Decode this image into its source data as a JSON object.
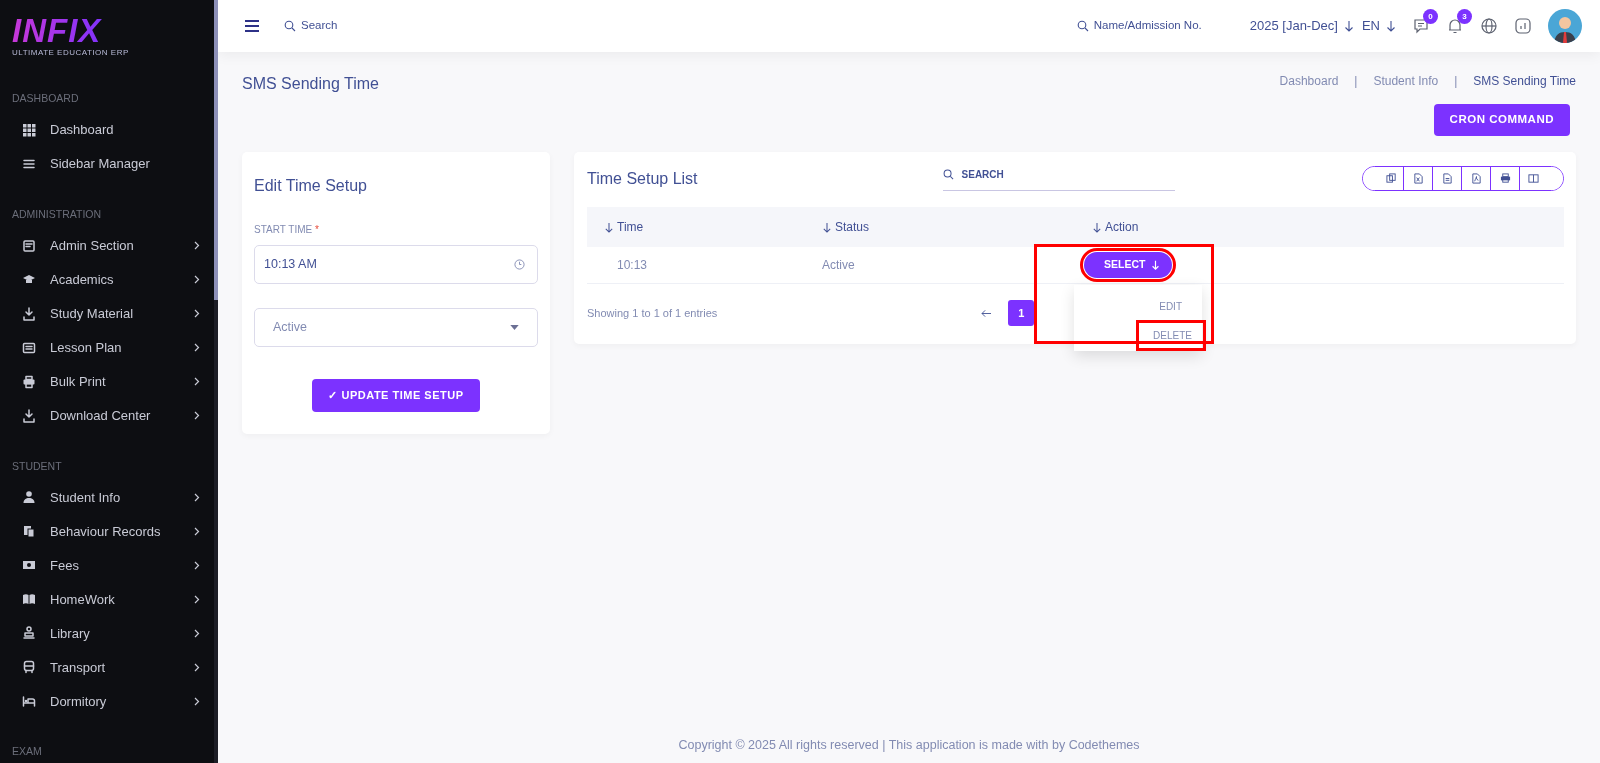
{
  "brand": {
    "name": "INFIX",
    "tagline": "ULTIMATE EDUCATION ERP"
  },
  "sidebar": {
    "sections": [
      {
        "title": "DASHBOARD",
        "items": [
          {
            "label": "Dashboard",
            "has_submenu": false
          },
          {
            "label": "Sidebar Manager",
            "has_submenu": false
          }
        ]
      },
      {
        "title": "ADMINISTRATION",
        "items": [
          {
            "label": "Admin Section",
            "has_submenu": true
          },
          {
            "label": "Academics",
            "has_submenu": true
          },
          {
            "label": "Study Material",
            "has_submenu": true
          },
          {
            "label": "Lesson Plan",
            "has_submenu": true
          },
          {
            "label": "Bulk Print",
            "has_submenu": true
          },
          {
            "label": "Download Center",
            "has_submenu": true
          }
        ]
      },
      {
        "title": "STUDENT",
        "items": [
          {
            "label": "Student Info",
            "has_submenu": true
          },
          {
            "label": "Behaviour Records",
            "has_submenu": true
          },
          {
            "label": "Fees",
            "has_submenu": true
          },
          {
            "label": "HomeWork",
            "has_submenu": true
          },
          {
            "label": "Library",
            "has_submenu": true
          },
          {
            "label": "Transport",
            "has_submenu": true
          },
          {
            "label": "Dormitory",
            "has_submenu": true
          }
        ]
      },
      {
        "title": "EXAM"
      }
    ]
  },
  "topbar": {
    "search_placeholder": "Search",
    "student_search_placeholder": "Name/Admission No.",
    "session": "2025 [Jan-Dec]",
    "language": "EN",
    "messages_count": "0",
    "notifications_count": "3"
  },
  "page": {
    "title": "SMS Sending Time",
    "breadcrumb": [
      "Dashboard",
      "Student Info",
      "SMS Sending Time"
    ],
    "breadcrumb_separators": [
      "|",
      "|"
    ],
    "cron_button": "CRON COMMAND"
  },
  "edit_form": {
    "title": "Edit Time Setup",
    "start_time_label": "START TIME",
    "required_mark": "*",
    "start_time_value": "10:13 AM",
    "status_value": "Active",
    "submit_icon": "✓",
    "submit_label": "UPDATE TIME SETUP"
  },
  "list": {
    "title": "Time Setup List",
    "search_placeholder": "SEARCH",
    "columns": [
      "Time",
      "Status",
      "Action"
    ],
    "rows": [
      {
        "time": "10:13",
        "status": "Active",
        "action": "SELECT",
        "menu_open": true,
        "highlighted": true
      }
    ],
    "action_menu": [
      {
        "label": "EDIT",
        "highlighted": false
      },
      {
        "label": "DELETE",
        "highlighted": true
      }
    ],
    "info": "Showing 1 to 1 of 1 entries",
    "pages": [
      {
        "label": "1",
        "selected": true
      }
    ]
  },
  "footer": "Copyright © 2025 All rights reserved | This application is made with by Codethemes"
}
